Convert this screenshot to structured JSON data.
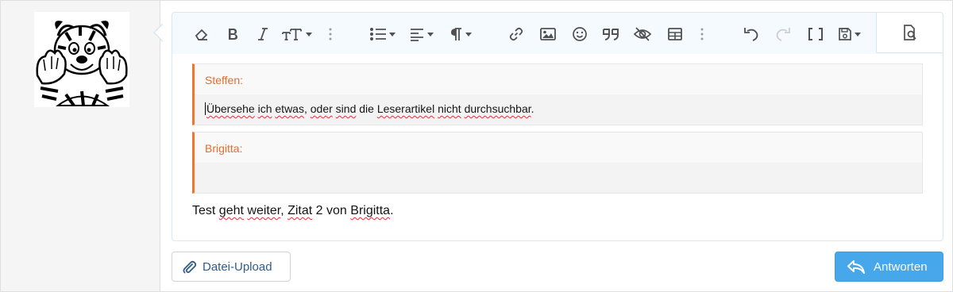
{
  "toolbar": {
    "buttons": [
      {
        "name": "remove-formatting-button",
        "icon": "eraser-icon"
      },
      {
        "name": "bold-button",
        "icon": "bold-icon"
      },
      {
        "name": "italic-button",
        "icon": "italic-icon"
      },
      {
        "name": "text-size-button",
        "icon": "text-size-icon"
      },
      {
        "name": "more-text-options-button",
        "icon": "more-vertical-icon"
      },
      {
        "name": "list-button",
        "icon": "list-icon"
      },
      {
        "name": "align-button",
        "icon": "align-left-icon"
      },
      {
        "name": "paragraph-button",
        "icon": "paragraph-icon"
      },
      {
        "name": "insert-link-button",
        "icon": "link-icon"
      },
      {
        "name": "insert-image-button",
        "icon": "image-icon"
      },
      {
        "name": "insert-emoji-button",
        "icon": "smiley-icon"
      },
      {
        "name": "quote-button",
        "icon": "quote-icon"
      },
      {
        "name": "spoiler-button",
        "icon": "eye-slash-icon"
      },
      {
        "name": "insert-table-button",
        "icon": "table-icon"
      },
      {
        "name": "more-insert-options-button",
        "icon": "more-vertical-icon"
      },
      {
        "name": "undo-button",
        "icon": "undo-icon"
      },
      {
        "name": "redo-button",
        "icon": "redo-icon"
      },
      {
        "name": "toggle-bbcode-button",
        "icon": "brackets-icon"
      },
      {
        "name": "drafts-button",
        "icon": "floppy-disk-icon"
      },
      {
        "name": "preview-button",
        "icon": "preview-icon"
      }
    ]
  },
  "quotes": [
    {
      "author": "Steffen:",
      "text": "Übersehe ich etwas, oder sind die Leserartikel nicht durchsuchbar."
    },
    {
      "author": "Brigitta:",
      "text": ""
    }
  ],
  "body_text": "Test geht weiter, Zitat 2 von Brigitta.",
  "buttons": {
    "upload_label": "Datei-Upload",
    "reply_label": "Antworten"
  },
  "colors": {
    "quote_accent": "#f07530",
    "quote_author": "#e66c2c",
    "primary_button": "#47a7eb",
    "link_text": "#2f5b8d"
  }
}
